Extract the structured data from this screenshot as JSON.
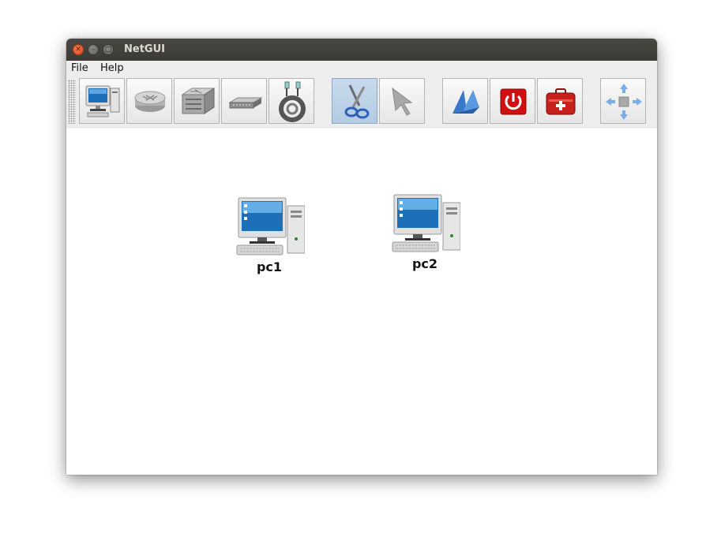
{
  "window": {
    "title": "NetGUI"
  },
  "menu": [
    "File",
    "Help"
  ],
  "toolbar": {
    "tools": [
      {
        "name": "terminal-pc-tool",
        "icon": "computer-icon"
      },
      {
        "name": "router-tool",
        "icon": "router-icon"
      },
      {
        "name": "switch-tool",
        "icon": "switch-icon"
      },
      {
        "name": "hub-tool",
        "icon": "hub-icon"
      },
      {
        "name": "link-tool",
        "icon": "cable-icon"
      },
      {
        "name": "delete-tool",
        "icon": "scissors-icon",
        "active": true
      },
      {
        "name": "select-tool",
        "icon": "pointer-icon"
      },
      {
        "name": "start-tool",
        "icon": "start-arrows-icon"
      },
      {
        "name": "power-off-tool",
        "icon": "power-icon"
      },
      {
        "name": "first-aid-tool",
        "icon": "first-aid-kit-icon"
      },
      {
        "name": "center-view-tool",
        "icon": "move-arrows-icon"
      }
    ]
  },
  "nodes": [
    {
      "label": "pc1",
      "icon": "computer-icon"
    },
    {
      "label": "pc2",
      "icon": "computer-icon"
    }
  ],
  "colors": {
    "titlebar": "#3c3b37",
    "active_tool": "#b9cfe6",
    "power_red": "#d01010",
    "screen_blue": "#1c6fb8"
  }
}
